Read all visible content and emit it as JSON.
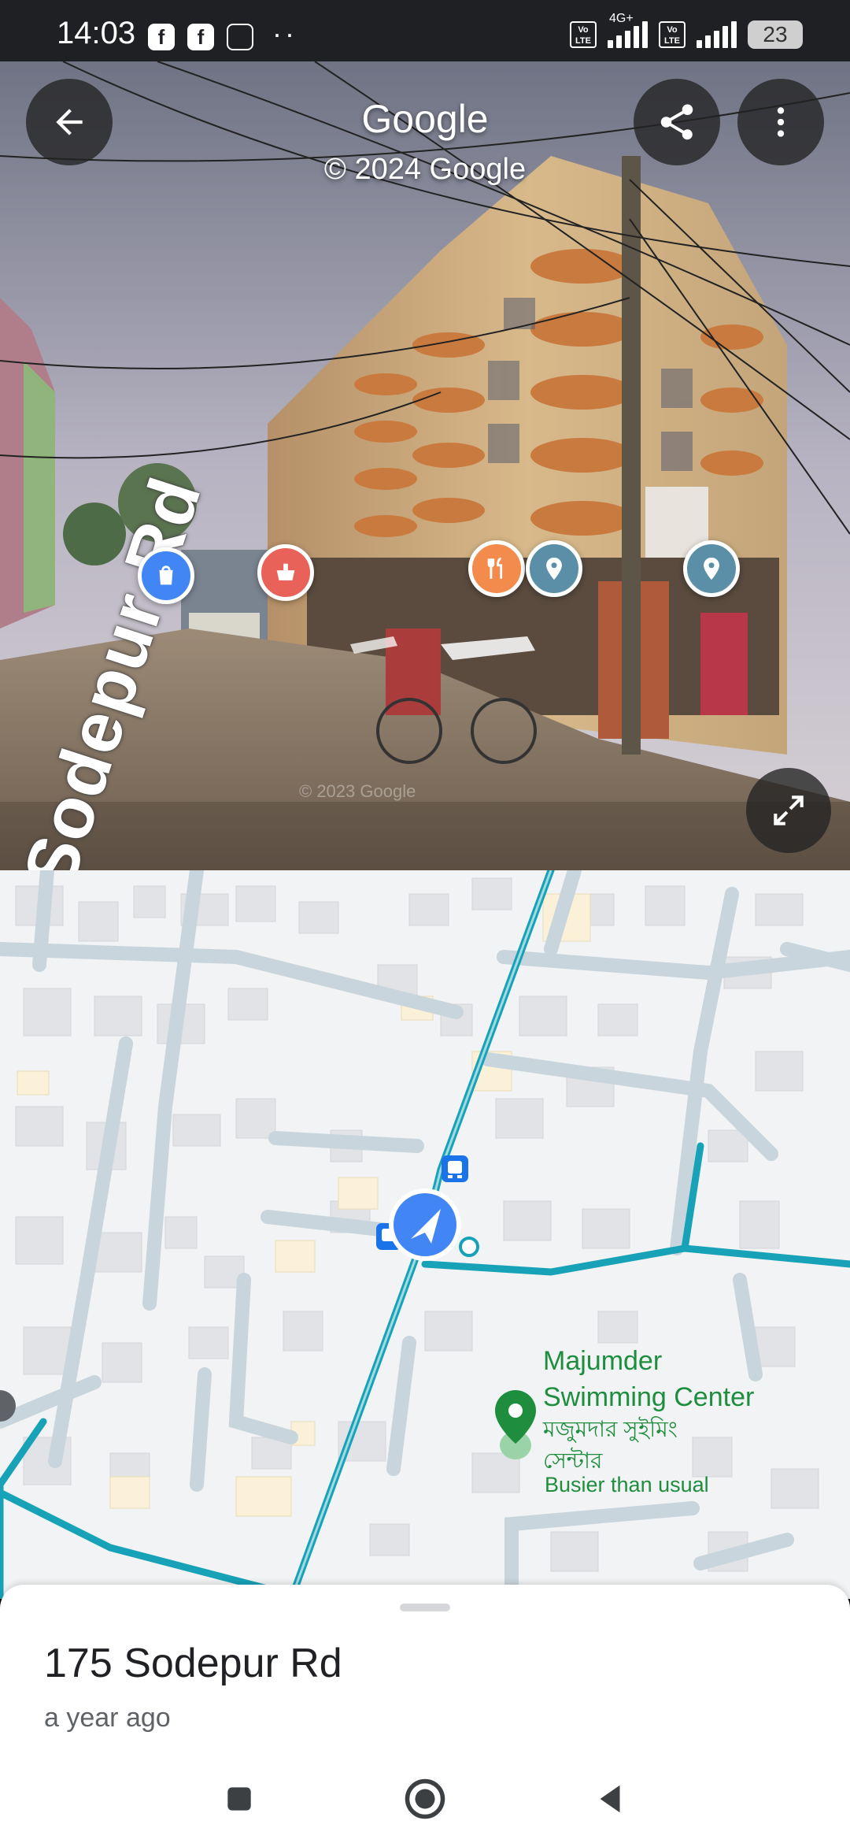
{
  "status_bar": {
    "time": "14:03",
    "apps": [
      "f",
      "f"
    ],
    "more": "··",
    "sim1": "Vo LTE",
    "network": "4G+",
    "sim2": "Vo LTE",
    "battery": "23"
  },
  "streetview": {
    "title": "Google",
    "copyright": "© 2024 Google",
    "watermark": "© 2023 Google",
    "road_label": "Sodepur Rd",
    "buttons": {
      "back": "back-icon",
      "share": "share-icon",
      "more": "more-vert-icon",
      "expand": "expand-icon"
    },
    "poi_markers": [
      {
        "name": "shopping-bag-icon",
        "color": "#4285f4"
      },
      {
        "name": "pharmacy-icon",
        "color": "#e8625a"
      },
      {
        "name": "restaurant-icon",
        "color": "#f28b4c"
      },
      {
        "name": "place-icon",
        "color": "#5b8fa8"
      },
      {
        "name": "place-icon",
        "color": "#5b8fa8"
      }
    ]
  },
  "map": {
    "colors": {
      "background": "#f1f3f4",
      "building": "#e1e3e6",
      "road": "#c8d5dc",
      "route": "#17a2b8",
      "transit": "#1a73e8"
    },
    "place": {
      "name": "Majumder Swimming Center",
      "name_line1": "Majumder",
      "name_line2": "Swimming Center",
      "bengali_line1": "মজুমদার সুইমিং",
      "bengali_line2": "সেন্টার",
      "status": "Busier than usual"
    }
  },
  "sheet": {
    "address": "175 Sodepur Rd",
    "time_ago": "a year ago"
  },
  "navbar": {
    "recents": "recents-icon",
    "home": "home-icon",
    "back": "nav-back-icon"
  }
}
